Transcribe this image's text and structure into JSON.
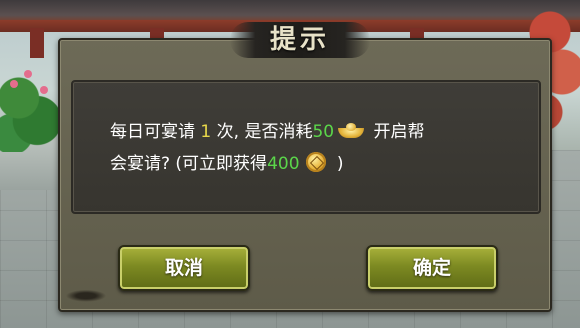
{
  "dialog": {
    "title": "提示",
    "message": {
      "part1": "每日可宴请 ",
      "invite_count": "1",
      "part2": " 次, 是否消耗",
      "cost": "50",
      "part3": " 开启帮",
      "line2_part1": "会宴请?  (可立即获得",
      "reward": "400",
      "line2_part3": " )",
      "cost_icon": "gold-ingot-icon",
      "reward_icon": "coin-icon"
    },
    "buttons": {
      "cancel_label": "取消",
      "confirm_label": "确定"
    }
  },
  "colors": {
    "invite_count": "#e8d84a",
    "cost": "#5bd64a",
    "reward": "#5bd64a",
    "button_green": "#7d8a22",
    "panel": "#6d6a57",
    "content_bg": "#3f3d38"
  }
}
